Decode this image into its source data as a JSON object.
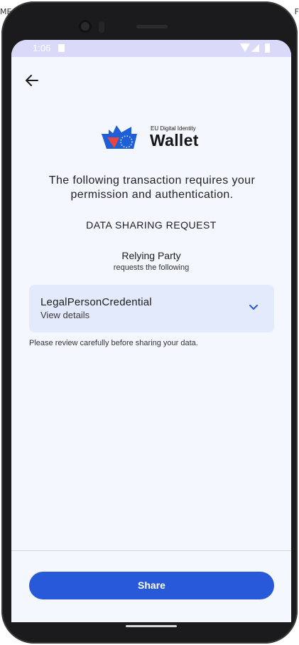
{
  "background": {
    "left_text": "ME",
    "right_text": "F"
  },
  "status_bar": {
    "time": "1:06",
    "icons": [
      "sd-card-icon",
      "wifi-icon",
      "signal-icon",
      "battery-icon"
    ]
  },
  "header": {
    "back_icon": "arrow-left-icon"
  },
  "logo": {
    "small_text": "EU Digital Identity",
    "big_text": "Wallet"
  },
  "intro_text": "The following transaction requires your permission and authentication.",
  "section_title": "DATA SHARING REQUEST",
  "relying_party": {
    "name": "Relying Party",
    "subtitle": "requests the following"
  },
  "credential_card": {
    "title": "LegalPersonCredential",
    "subtitle": "View details",
    "icon": "chevron-down-icon"
  },
  "review_note": "Please review carefully before sharing your data.",
  "share_button": {
    "label": "Share"
  },
  "colors": {
    "accent": "#2859d8",
    "card_background": "#e3eafb",
    "screen_background": "#f4f7fd",
    "status_bar": "#d9dafa",
    "logo_blue": "#1f5fd6",
    "logo_red": "#e8453c"
  }
}
